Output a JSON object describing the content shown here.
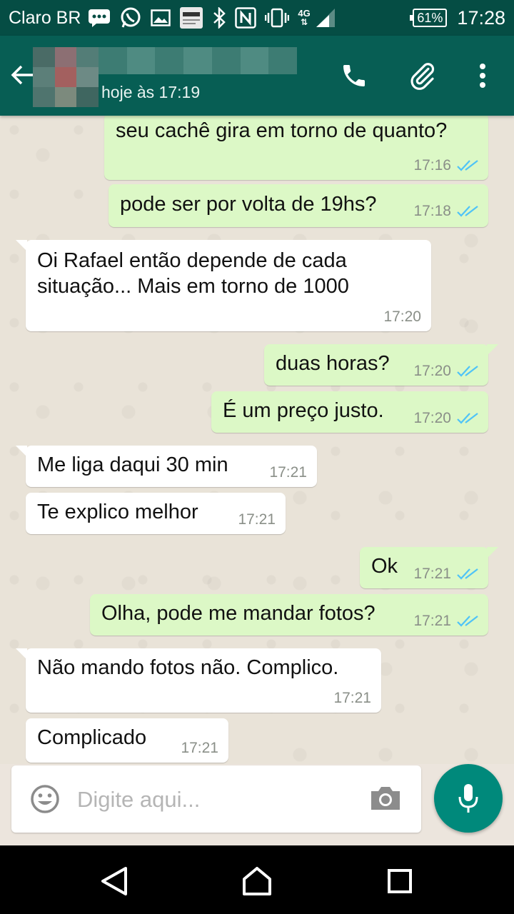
{
  "status_bar": {
    "carrier": "Claro BR",
    "network": "4G",
    "battery": "61%",
    "time": "17:28",
    "icons": [
      "chat-bubble-icon",
      "whatsapp-icon",
      "image-icon",
      "folha-app-icon",
      "bluetooth-icon",
      "nfc-icon",
      "vibrate-icon",
      "signal-icon"
    ]
  },
  "header": {
    "last_seen": "hoje às 17:19",
    "icons": [
      "back-arrow-icon",
      "phone-icon",
      "paperclip-icon",
      "more-vert-icon"
    ]
  },
  "messages": [
    {
      "direction": "out",
      "text": "seu cachê gira em torno de quanto?",
      "time": "17:16",
      "read": true
    },
    {
      "direction": "out",
      "text": "pode ser por volta de 19hs?",
      "time": "17:18",
      "read": true
    },
    {
      "direction": "in",
      "lines": [
        "Oi Rafael então depende de cada",
        "situação... Mais em torno de 1000"
      ],
      "time": "17:20"
    },
    {
      "direction": "out",
      "text": "duas horas?",
      "time": "17:20",
      "read": true
    },
    {
      "direction": "out",
      "text": "É um preço justo.",
      "time": "17:20",
      "read": true
    },
    {
      "direction": "in",
      "text": "Me liga daqui 30 min",
      "time": "17:21"
    },
    {
      "direction": "in",
      "text": "Te explico melhor",
      "time": "17:21"
    },
    {
      "direction": "out",
      "text": "Ok",
      "time": "17:21",
      "read": true
    },
    {
      "direction": "out",
      "text": "Olha, pode me mandar fotos?",
      "time": "17:21",
      "read": true
    },
    {
      "direction": "in",
      "text": "Não mando fotos não. Complico.",
      "time": "17:21"
    },
    {
      "direction": "in",
      "text": "Complicado",
      "time": "17:21"
    }
  ],
  "composer": {
    "placeholder": "Digite aqui...",
    "icons": [
      "emoji-icon",
      "camera-icon",
      "mic-icon"
    ]
  },
  "colors": {
    "header": "#075e54",
    "status_bar": "#054d44",
    "outgoing_bubble": "#dcf8c6",
    "incoming_bubble": "#ffffff",
    "read_ticks": "#4fc3f7",
    "mic_button": "#00897b"
  }
}
